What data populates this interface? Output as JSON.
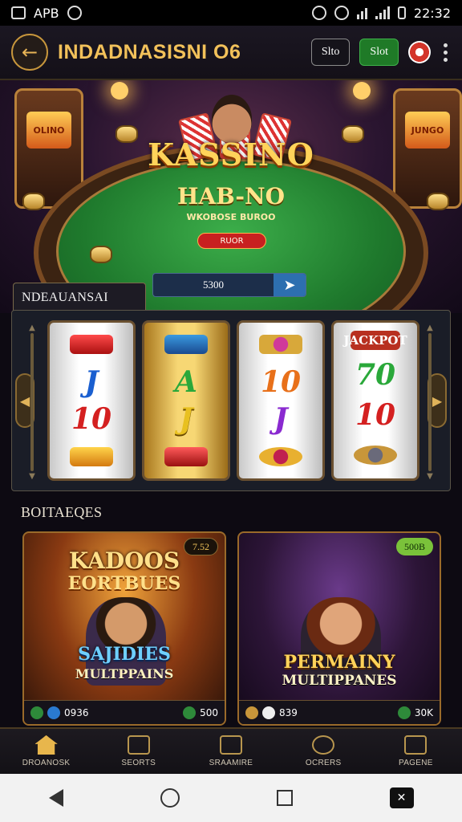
{
  "status_bar": {
    "left_text": "APB",
    "time": "22:32"
  },
  "header": {
    "title": "INDADNASISNI O6",
    "btn_dark": "Slto",
    "btn_green": "Slot"
  },
  "hero": {
    "logo_main": "KASSINO",
    "logo_sub": "HAB-NO",
    "tagline": "WKOBOSE BUROO",
    "cta": "RUOR",
    "arcade_left": "OLINO",
    "arcade_right": "JUNGO",
    "bet_value": "5300"
  },
  "slots": {
    "tab_label": "NDEAUANSAI",
    "reels": [
      {
        "symbols": [
          "J",
          "10"
        ]
      },
      {
        "symbols": [
          "A",
          "J"
        ]
      },
      {
        "symbols": [
          "10",
          "J"
        ]
      },
      {
        "symbols": [
          "70",
          "10"
        ],
        "top_label": "JACKPOT"
      }
    ]
  },
  "featured": {
    "title": "BOITAEQES",
    "cards": [
      {
        "badge": "7.52",
        "line1": "KADOOS",
        "line2": "EORTBUES",
        "line3": "SAJIDIES",
        "line4": "MULTPPAINS",
        "footer_left": "0936",
        "footer_right": "500"
      },
      {
        "badge": "500B",
        "line3": "PERMAINY",
        "line4": "MULTIPPANES",
        "footer_left": "839",
        "footer_right": "30K"
      }
    ]
  },
  "bottom_nav": [
    {
      "label": "DROANOSK",
      "icon": "home-icon"
    },
    {
      "label": "SEORTS",
      "icon": "slots-icon"
    },
    {
      "label": "SRAAMIRE",
      "icon": "gift-icon"
    },
    {
      "label": "OCRERS",
      "icon": "globe-icon"
    },
    {
      "label": "PAGENE",
      "icon": "menu-icon"
    }
  ],
  "colors": {
    "accent_gold": "#e8b64c",
    "felt_green": "#1f7a2d",
    "chip_red": "#c82020"
  }
}
